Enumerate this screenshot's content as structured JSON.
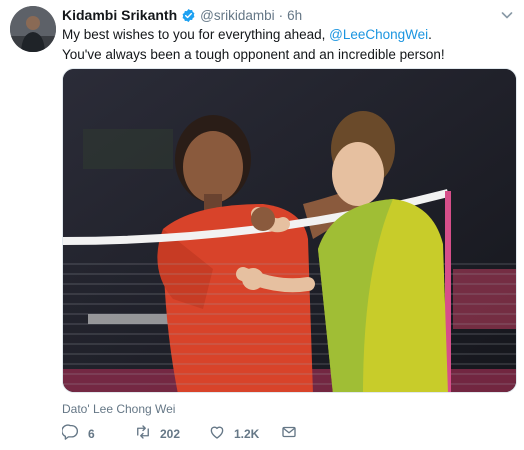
{
  "tweet": {
    "author_name": "Kidambi Srikanth",
    "handle": "@srikidambi",
    "separator": "·",
    "time": "6h",
    "text_line1_prefix": "My best wishes to you for everything ahead, ",
    "mention": "@LeeChongWei",
    "text_line1_suffix": ".",
    "text_line2": "You've always been a tough opponent and an incredible person!",
    "media_caption": "Dato' Lee Chong Wei"
  },
  "actions": {
    "replies": "6",
    "retweets": "202",
    "likes": "1.2K"
  },
  "icons": {
    "avatar": "avatar",
    "verified": "verified-badge-icon",
    "caret": "chevron-down-icon",
    "reply": "reply-icon",
    "retweet": "retweet-icon",
    "like": "heart-icon",
    "message": "envelope-icon"
  },
  "colors": {
    "link": "#1b95e0",
    "muted": "#657786",
    "text": "#14171a",
    "verified": "#1da1f2"
  }
}
